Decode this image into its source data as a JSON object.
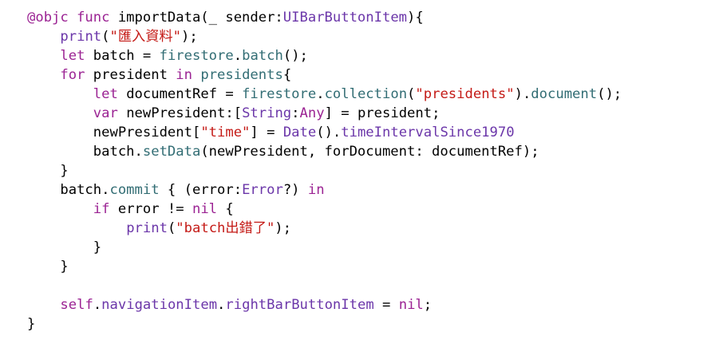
{
  "colors": {
    "keyword": "#9b2393",
    "type": "#6b36a9",
    "function": "#326d74",
    "string": "#c41a16",
    "plain": "#000000",
    "background": "#ffffff"
  },
  "code": {
    "lines": [
      [
        {
          "t": "kw",
          "s": "@objc func "
        },
        {
          "t": "plain",
          "s": "importData(_ sender:"
        },
        {
          "t": "type",
          "s": "UIBarButtonItem"
        },
        {
          "t": "plain",
          "s": "){"
        }
      ],
      [
        {
          "t": "plain",
          "s": "    "
        },
        {
          "t": "type",
          "s": "print"
        },
        {
          "t": "plain",
          "s": "("
        },
        {
          "t": "str",
          "s": "\"匯入資料\""
        },
        {
          "t": "plain",
          "s": ");"
        }
      ],
      [
        {
          "t": "plain",
          "s": "    "
        },
        {
          "t": "kw",
          "s": "let"
        },
        {
          "t": "plain",
          "s": " batch = "
        },
        {
          "t": "func",
          "s": "firestore"
        },
        {
          "t": "plain",
          "s": "."
        },
        {
          "t": "func",
          "s": "batch"
        },
        {
          "t": "plain",
          "s": "();"
        }
      ],
      [
        {
          "t": "plain",
          "s": "    "
        },
        {
          "t": "kw",
          "s": "for"
        },
        {
          "t": "plain",
          "s": " president "
        },
        {
          "t": "kw",
          "s": "in"
        },
        {
          "t": "plain",
          "s": " "
        },
        {
          "t": "func",
          "s": "presidents"
        },
        {
          "t": "plain",
          "s": "{"
        }
      ],
      [
        {
          "t": "plain",
          "s": "        "
        },
        {
          "t": "kw",
          "s": "let"
        },
        {
          "t": "plain",
          "s": " documentRef = "
        },
        {
          "t": "func",
          "s": "firestore"
        },
        {
          "t": "plain",
          "s": "."
        },
        {
          "t": "func",
          "s": "collection"
        },
        {
          "t": "plain",
          "s": "("
        },
        {
          "t": "str",
          "s": "\"presidents\""
        },
        {
          "t": "plain",
          "s": ")."
        },
        {
          "t": "func",
          "s": "document"
        },
        {
          "t": "plain",
          "s": "();"
        }
      ],
      [
        {
          "t": "plain",
          "s": "        "
        },
        {
          "t": "kw",
          "s": "var"
        },
        {
          "t": "plain",
          "s": " newPresident:["
        },
        {
          "t": "type",
          "s": "String"
        },
        {
          "t": "plain",
          "s": ":"
        },
        {
          "t": "kw",
          "s": "Any"
        },
        {
          "t": "plain",
          "s": "] = president;"
        }
      ],
      [
        {
          "t": "plain",
          "s": "        newPresident["
        },
        {
          "t": "str",
          "s": "\"time\""
        },
        {
          "t": "plain",
          "s": "] = "
        },
        {
          "t": "type",
          "s": "Date"
        },
        {
          "t": "plain",
          "s": "()."
        },
        {
          "t": "type",
          "s": "timeIntervalSince1970"
        }
      ],
      [
        {
          "t": "plain",
          "s": "        batch."
        },
        {
          "t": "func",
          "s": "setData"
        },
        {
          "t": "plain",
          "s": "(newPresident, forDocument: documentRef);"
        }
      ],
      [
        {
          "t": "plain",
          "s": "    }"
        }
      ],
      [
        {
          "t": "plain",
          "s": "    batch."
        },
        {
          "t": "func",
          "s": "commit"
        },
        {
          "t": "plain",
          "s": " { (error:"
        },
        {
          "t": "type",
          "s": "Error"
        },
        {
          "t": "plain",
          "s": "?) "
        },
        {
          "t": "kw",
          "s": "in"
        }
      ],
      [
        {
          "t": "plain",
          "s": "        "
        },
        {
          "t": "kw",
          "s": "if"
        },
        {
          "t": "plain",
          "s": " error != "
        },
        {
          "t": "kw",
          "s": "nil"
        },
        {
          "t": "plain",
          "s": " {"
        }
      ],
      [
        {
          "t": "plain",
          "s": "            "
        },
        {
          "t": "type",
          "s": "print"
        },
        {
          "t": "plain",
          "s": "("
        },
        {
          "t": "str",
          "s": "\"batch出錯了\""
        },
        {
          "t": "plain",
          "s": ");"
        }
      ],
      [
        {
          "t": "plain",
          "s": "        }"
        }
      ],
      [
        {
          "t": "plain",
          "s": "    }"
        }
      ],
      [
        {
          "t": "plain",
          "s": ""
        }
      ],
      [
        {
          "t": "plain",
          "s": "    "
        },
        {
          "t": "kw",
          "s": "self"
        },
        {
          "t": "plain",
          "s": "."
        },
        {
          "t": "type",
          "s": "navigationItem"
        },
        {
          "t": "plain",
          "s": "."
        },
        {
          "t": "type",
          "s": "rightBarButtonItem"
        },
        {
          "t": "plain",
          "s": " = "
        },
        {
          "t": "kw",
          "s": "nil"
        },
        {
          "t": "plain",
          "s": ";"
        }
      ],
      [
        {
          "t": "plain",
          "s": "}"
        }
      ]
    ]
  }
}
